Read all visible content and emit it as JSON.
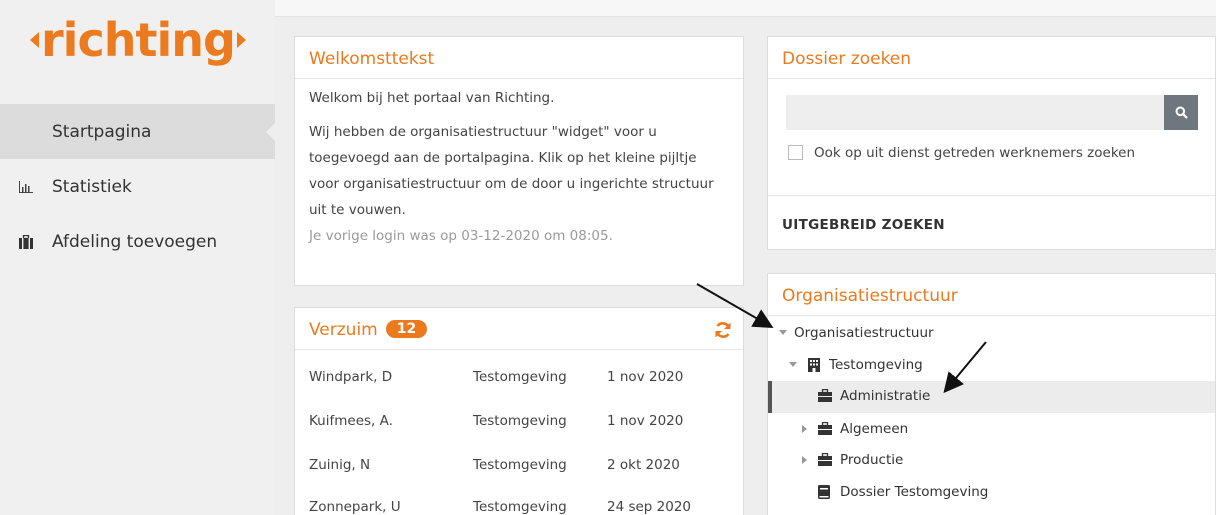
{
  "app": {
    "logo_text": "richting"
  },
  "sidebar": {
    "items": [
      {
        "label": "Startpagina",
        "icon": "",
        "active": true
      },
      {
        "label": "Statistiek",
        "icon": "bar-chart-icon"
      },
      {
        "label": "Afdeling toevoegen",
        "icon": "briefcase-icon"
      }
    ]
  },
  "welkom": {
    "title": "Welkomsttekst",
    "line1": "Welkom bij het portaal van Richting.",
    "line2": "Wij hebben de organisatiestructuur \"widget\" voor u",
    "line3": "toegevoegd aan de portalpagina. Klik op het kleine pijltje",
    "line4": "voor organisatiestructuur om de door u ingerichte structuur",
    "line5": "uit te vouwen.",
    "last_login": "Je vorige login was op 03-12-2020 om 08:05."
  },
  "verzuim": {
    "title": "Verzuim",
    "count": "12",
    "rows": [
      {
        "name": "Windpark, D",
        "dept": "Testomgeving",
        "date": "1 nov 2020"
      },
      {
        "name": "Kuifmees, A.",
        "dept": "Testomgeving",
        "date": "1 nov 2020"
      },
      {
        "name": "Zuinig, N",
        "dept": "Testomgeving",
        "date": "2 okt 2020"
      },
      {
        "name": "Zonnepark, U",
        "dept": "Testomgeving",
        "date": "24 sep 2020"
      }
    ]
  },
  "dossier": {
    "title": "Dossier zoeken",
    "search_placeholder": "",
    "checkbox_label": "Ook op uit dienst getreden werknemers zoeken",
    "advanced": "UITGEBREID ZOEKEN"
  },
  "org": {
    "title": "Organisatiestructuur",
    "tree": [
      {
        "label": "Organisatiestructuur",
        "icon": ""
      },
      {
        "label": "Testomgeving",
        "icon": "building-icon"
      },
      {
        "label": "Administratie",
        "icon": "briefcase-icon",
        "selected": true
      },
      {
        "label": "Algemeen",
        "icon": "briefcase-icon"
      },
      {
        "label": "Productie",
        "icon": "briefcase-icon"
      },
      {
        "label": "Dossier Testomgeving",
        "icon": "book-icon"
      }
    ]
  },
  "colors": {
    "accent": "#ea7a1d",
    "sidebar_bg": "#f0f0f0",
    "active_bg": "#dcdcdc"
  }
}
